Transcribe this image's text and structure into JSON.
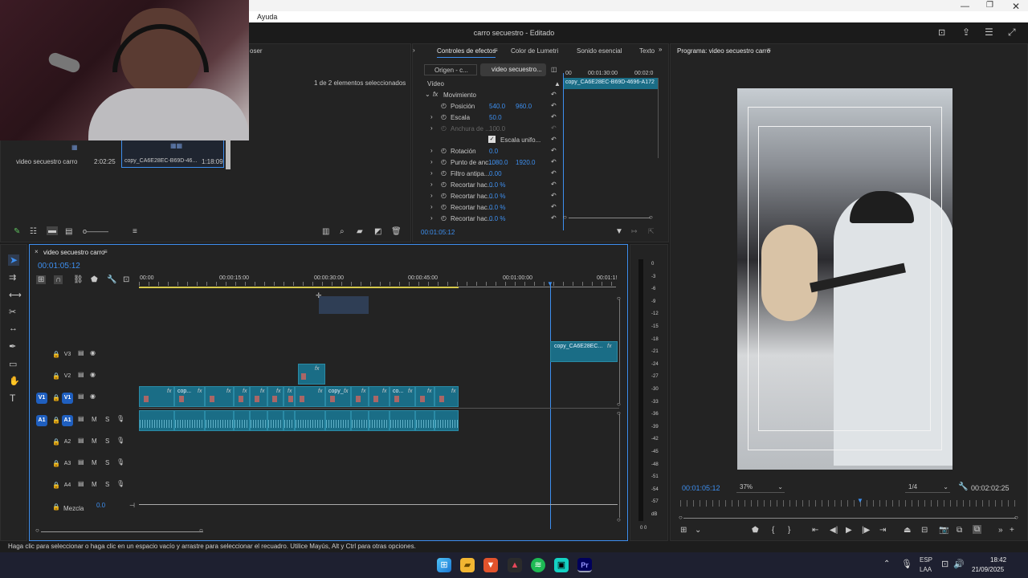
{
  "menu": {
    "help": "Ayuda"
  },
  "app": {
    "title": "carro secuestro",
    "state": "- Editado"
  },
  "project_panel": {
    "tab_partial": "oser",
    "selection_info": "1 de 2 elementos seleccionados",
    "items": [
      {
        "name": "video secuestro carro",
        "duration": "2:02:25"
      },
      {
        "name": "copy_CA6E28EC-B69D-46...",
        "duration": "1:18:09"
      }
    ]
  },
  "effects_panel": {
    "tabs": [
      "Controles de efectos",
      "Color de Lumetri",
      "Sonido esencial",
      "Texto"
    ],
    "source_tab": "Origen - c...",
    "seq_tab": "video secuestro...",
    "clip_label": "copy_CA6E28EC-B69D-4696-A172",
    "section": "Vídeo",
    "movement": "Movimiento",
    "rows": [
      {
        "label": "Posición",
        "v1": "540.0",
        "v2": "960.0"
      },
      {
        "label": "Escala",
        "v1": "50.0",
        "v2": ""
      },
      {
        "label": "Anchura de ...",
        "v1": "100.0",
        "v2": ""
      },
      {
        "label": "Escala unifo...",
        "v1": "",
        "v2": ""
      },
      {
        "label": "Rotación",
        "v1": "0.0",
        "v2": ""
      },
      {
        "label": "Punto de anc...",
        "v1": "1080.0",
        "v2": "1920.0"
      },
      {
        "label": "Filtro antipa...",
        "v1": "0.00",
        "v2": ""
      },
      {
        "label": "Recortar hac...",
        "v1": "0.0 %",
        "v2": ""
      },
      {
        "label": "Recortar hac...",
        "v1": "0.0 %",
        "v2": ""
      },
      {
        "label": "Recortar hac...",
        "v1": "0.0 %",
        "v2": ""
      },
      {
        "label": "Recortar hac...",
        "v1": "0.0 %",
        "v2": ""
      }
    ],
    "ruler": [
      "00",
      "00:01:30:00",
      "00:02:0"
    ],
    "timecode": "00:01:05:12"
  },
  "program_monitor": {
    "title": "Programa: video secuestro carro",
    "timecode": "00:01:05:12",
    "zoom": "37%",
    "quality": "1/4",
    "duration": "00:02:02:25"
  },
  "timeline": {
    "title": "video secuestro carro",
    "timecode": "00:01:05:12",
    "ruler": [
      "00:00",
      "00:00:15:00",
      "00:00:30:00",
      "00:00:45:00",
      "00:01:00:00",
      "00:01:1!"
    ],
    "tracks_v": [
      "V3",
      "V2",
      "V1"
    ],
    "tracks_a": [
      "A1",
      "A2",
      "A3",
      "A4"
    ],
    "mix_label": "Mezcla",
    "mix_value": "0.0",
    "v3_clip": "copy_CA6E28EC...",
    "v1_clips": [
      "cop...",
      "copy_...",
      "co..."
    ],
    "src_v": "V1",
    "src_a": "A1"
  },
  "meter": {
    "scale": [
      "0",
      "-3",
      "-6",
      "-9",
      "-12",
      "-15",
      "-18",
      "-21",
      "-24",
      "-27",
      "-30",
      "-33",
      "-36",
      "-39",
      "-42",
      "-45",
      "-48",
      "-51",
      "-54",
      "-57",
      "dB"
    ],
    "bottom": "0 0"
  },
  "status": {
    "text": "Haga clic para seleccionar o haga clic en un espacio vacío y arrastre para seleccionar el recuadro. Utilice Mayús, Alt y Ctrl para otras opciones."
  },
  "taskbar": {
    "lang": "ESP",
    "lang2": "LAA",
    "time": "18:42",
    "date": "21/09/2025"
  }
}
